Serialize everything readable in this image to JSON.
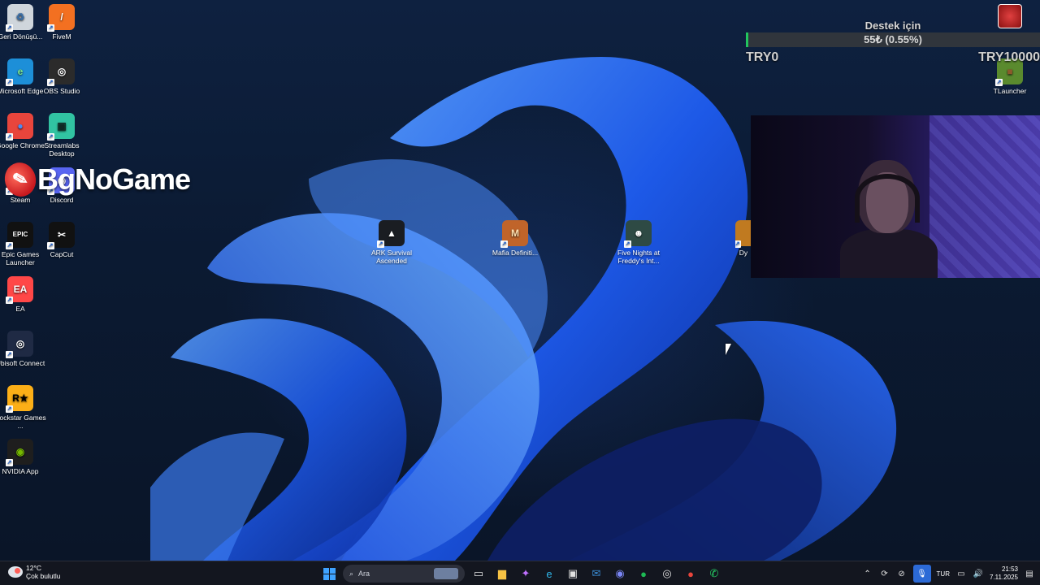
{
  "desktop": {
    "left_icons": [
      {
        "label": "Geri Dönüşü...",
        "icon": "recycle-bin-icon",
        "bg": "#cfd6dc",
        "glyph": "♻",
        "color": "#3a6ea5"
      },
      {
        "label": "FiveM",
        "icon": "fivem-icon",
        "bg": "#f37021",
        "glyph": "/",
        "color": "#ffffff"
      },
      {
        "label": "Microsoft Edge",
        "icon": "edge-icon",
        "bg": "#1d8fd8",
        "glyph": "e",
        "color": "#7be38c"
      },
      {
        "label": "OBS Studio",
        "icon": "obs-icon",
        "bg": "#2b2b2b",
        "glyph": "◎",
        "color": "#ffffff"
      },
      {
        "label": "Google Chrome",
        "icon": "chrome-icon",
        "bg": "#e8453c",
        "glyph": "●",
        "color": "#4a8af4"
      },
      {
        "label": "Streamlabs Desktop",
        "icon": "streamlabs-icon",
        "bg": "#31c3a2",
        "glyph": "▣",
        "color": "#0f2a24"
      },
      {
        "label": "Steam",
        "icon": "steam-icon",
        "bg": "#1b2838",
        "glyph": "⚙",
        "color": "#ffffff"
      },
      {
        "label": "Discord",
        "icon": "discord-icon",
        "bg": "#5865f2",
        "glyph": "◉",
        "color": "#ffffff"
      },
      {
        "label": "Epic Games Launcher",
        "icon": "epic-games-icon",
        "bg": "#111111",
        "glyph": "EPIC",
        "color": "#ffffff"
      },
      {
        "label": "CapCut",
        "icon": "capcut-icon",
        "bg": "#111111",
        "glyph": "✂",
        "color": "#ffffff"
      },
      {
        "label": "EA",
        "icon": "ea-icon",
        "bg": "#ff4747",
        "glyph": "EA",
        "color": "#ffffff"
      },
      {
        "label": "Ubisoft Connect",
        "icon": "ubisoft-icon",
        "bg": "#1f2a44",
        "glyph": "◎",
        "color": "#ffffff"
      },
      {
        "label": "Rockstar Games ...",
        "icon": "rockstar-icon",
        "bg": "#fcaf17",
        "glyph": "R★",
        "color": "#000000"
      },
      {
        "label": "NVIDIA App",
        "icon": "nvidia-icon",
        "bg": "#1e1e1e",
        "glyph": "◉",
        "color": "#76b900"
      }
    ],
    "center_icons": [
      {
        "label": "ARK Survival Ascended",
        "icon": "ark-icon",
        "bg": "#1a1d22",
        "glyph": "▲",
        "color": "#ffffff"
      },
      {
        "label": "Mafia Definiti...",
        "icon": "mafia-icon",
        "bg": "#c0642a",
        "glyph": "M",
        "color": "#ffe0b0"
      },
      {
        "label": "Five Nights at Freddy's Int...",
        "icon": "fnaf-icon",
        "bg": "#2e4a44",
        "glyph": "☻",
        "color": "#ffffff"
      },
      {
        "label": "Dy",
        "icon": "partial-app-icon",
        "bg": "#c07a20",
        "glyph": "",
        "color": "#ffffff"
      }
    ],
    "right_icons": [
      {
        "label": "TLauncher",
        "icon": "tlauncher-icon",
        "bg": "#5a8a2e",
        "glyph": "■",
        "color": "#8b5a2b"
      }
    ],
    "brand_overlay": {
      "text": "BgNoGame",
      "logo_glyph": "✎"
    }
  },
  "donation": {
    "title": "Destek için",
    "amount": "55₺ (0.55%)",
    "progress_fraction": 0.0055,
    "min": "TRY0",
    "max": "TRY10000",
    "fill_color": "#22c55e"
  },
  "webcam": {
    "icon": "webcam-feed"
  },
  "taskbar": {
    "weather": {
      "temp": "12°C",
      "condition": "Çok bulutlu"
    },
    "search_placeholder": "Ara",
    "apps": [
      {
        "name": "task-view",
        "glyph": "▭",
        "color": "#e0e0e0"
      },
      {
        "name": "file-explorer",
        "glyph": "▆",
        "color": "#f6c244"
      },
      {
        "name": "copilot",
        "glyph": "✦",
        "color": "#c070ff"
      },
      {
        "name": "edge",
        "glyph": "e",
        "color": "#2fb5e8"
      },
      {
        "name": "microsoft-store",
        "glyph": "▣",
        "color": "#e0e0e0"
      },
      {
        "name": "mail",
        "glyph": "✉",
        "color": "#3b8ed8"
      },
      {
        "name": "discord",
        "glyph": "◉",
        "color": "#7a86f5"
      },
      {
        "name": "spotify",
        "glyph": "●",
        "color": "#1db954"
      },
      {
        "name": "obs",
        "glyph": "◎",
        "color": "#e0e0e0"
      },
      {
        "name": "chrome",
        "glyph": "●",
        "color": "#e8453c"
      },
      {
        "name": "whatsapp",
        "glyph": "✆",
        "color": "#25d366"
      }
    ],
    "tray": {
      "language": "TUR",
      "time": "21:53",
      "date": "7.11.2025"
    }
  }
}
